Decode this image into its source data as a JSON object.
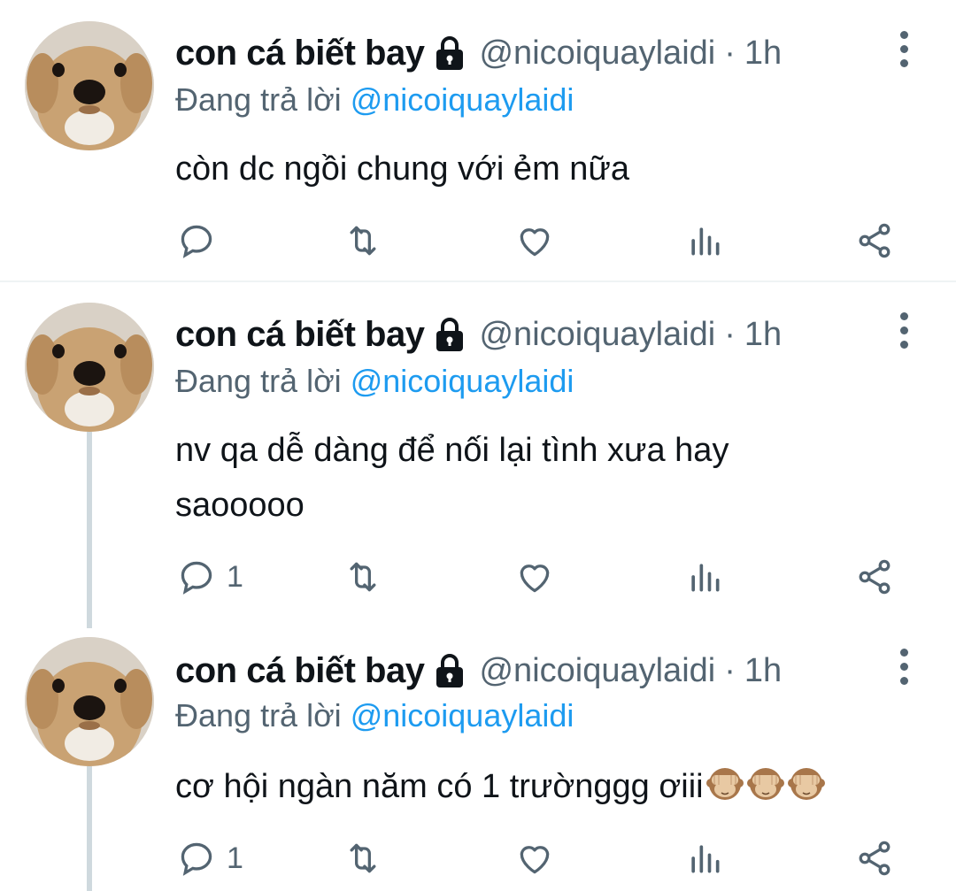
{
  "tweets": [
    {
      "display_name": "con cá biết bay",
      "handle": "@nicoiquaylaidi",
      "separator": "·",
      "time": "1h",
      "replying_prefix": "Đang trả lời",
      "replying_to": "@nicoiquaylaidi",
      "text": "còn dc ngồi chung với ẻm nữa",
      "reply_count": "",
      "has_thread_line": false
    },
    {
      "display_name": "con cá biết bay",
      "handle": "@nicoiquaylaidi",
      "separator": "·",
      "time": "1h",
      "replying_prefix": "Đang trả lời",
      "replying_to": "@nicoiquaylaidi",
      "text": "nv qa dễ dàng để nối lại tình xưa hay saooooo",
      "reply_count": "1",
      "has_thread_line": true
    },
    {
      "display_name": "con cá biết bay",
      "handle": "@nicoiquaylaidi",
      "separator": "·",
      "time": "1h",
      "replying_prefix": "Đang trả lời",
      "replying_to": "@nicoiquaylaidi",
      "text": "cơ hội ngàn năm có 1 trườnggg ơiii",
      "emoji": "see-no-evil-monkey x3",
      "reply_count": "1",
      "has_thread_line": true
    }
  ],
  "icons": [
    "lock-icon",
    "reply-icon",
    "retweet-icon",
    "like-icon",
    "analytics-icon",
    "share-icon",
    "more-icon",
    "see-no-evil-monkey-emoji"
  ],
  "colors": {
    "text": "#0f1419",
    "secondary": "#536471",
    "mention": "#1d9bf0",
    "divider": "#eff3f4",
    "thread_line": "#cfd9de"
  }
}
